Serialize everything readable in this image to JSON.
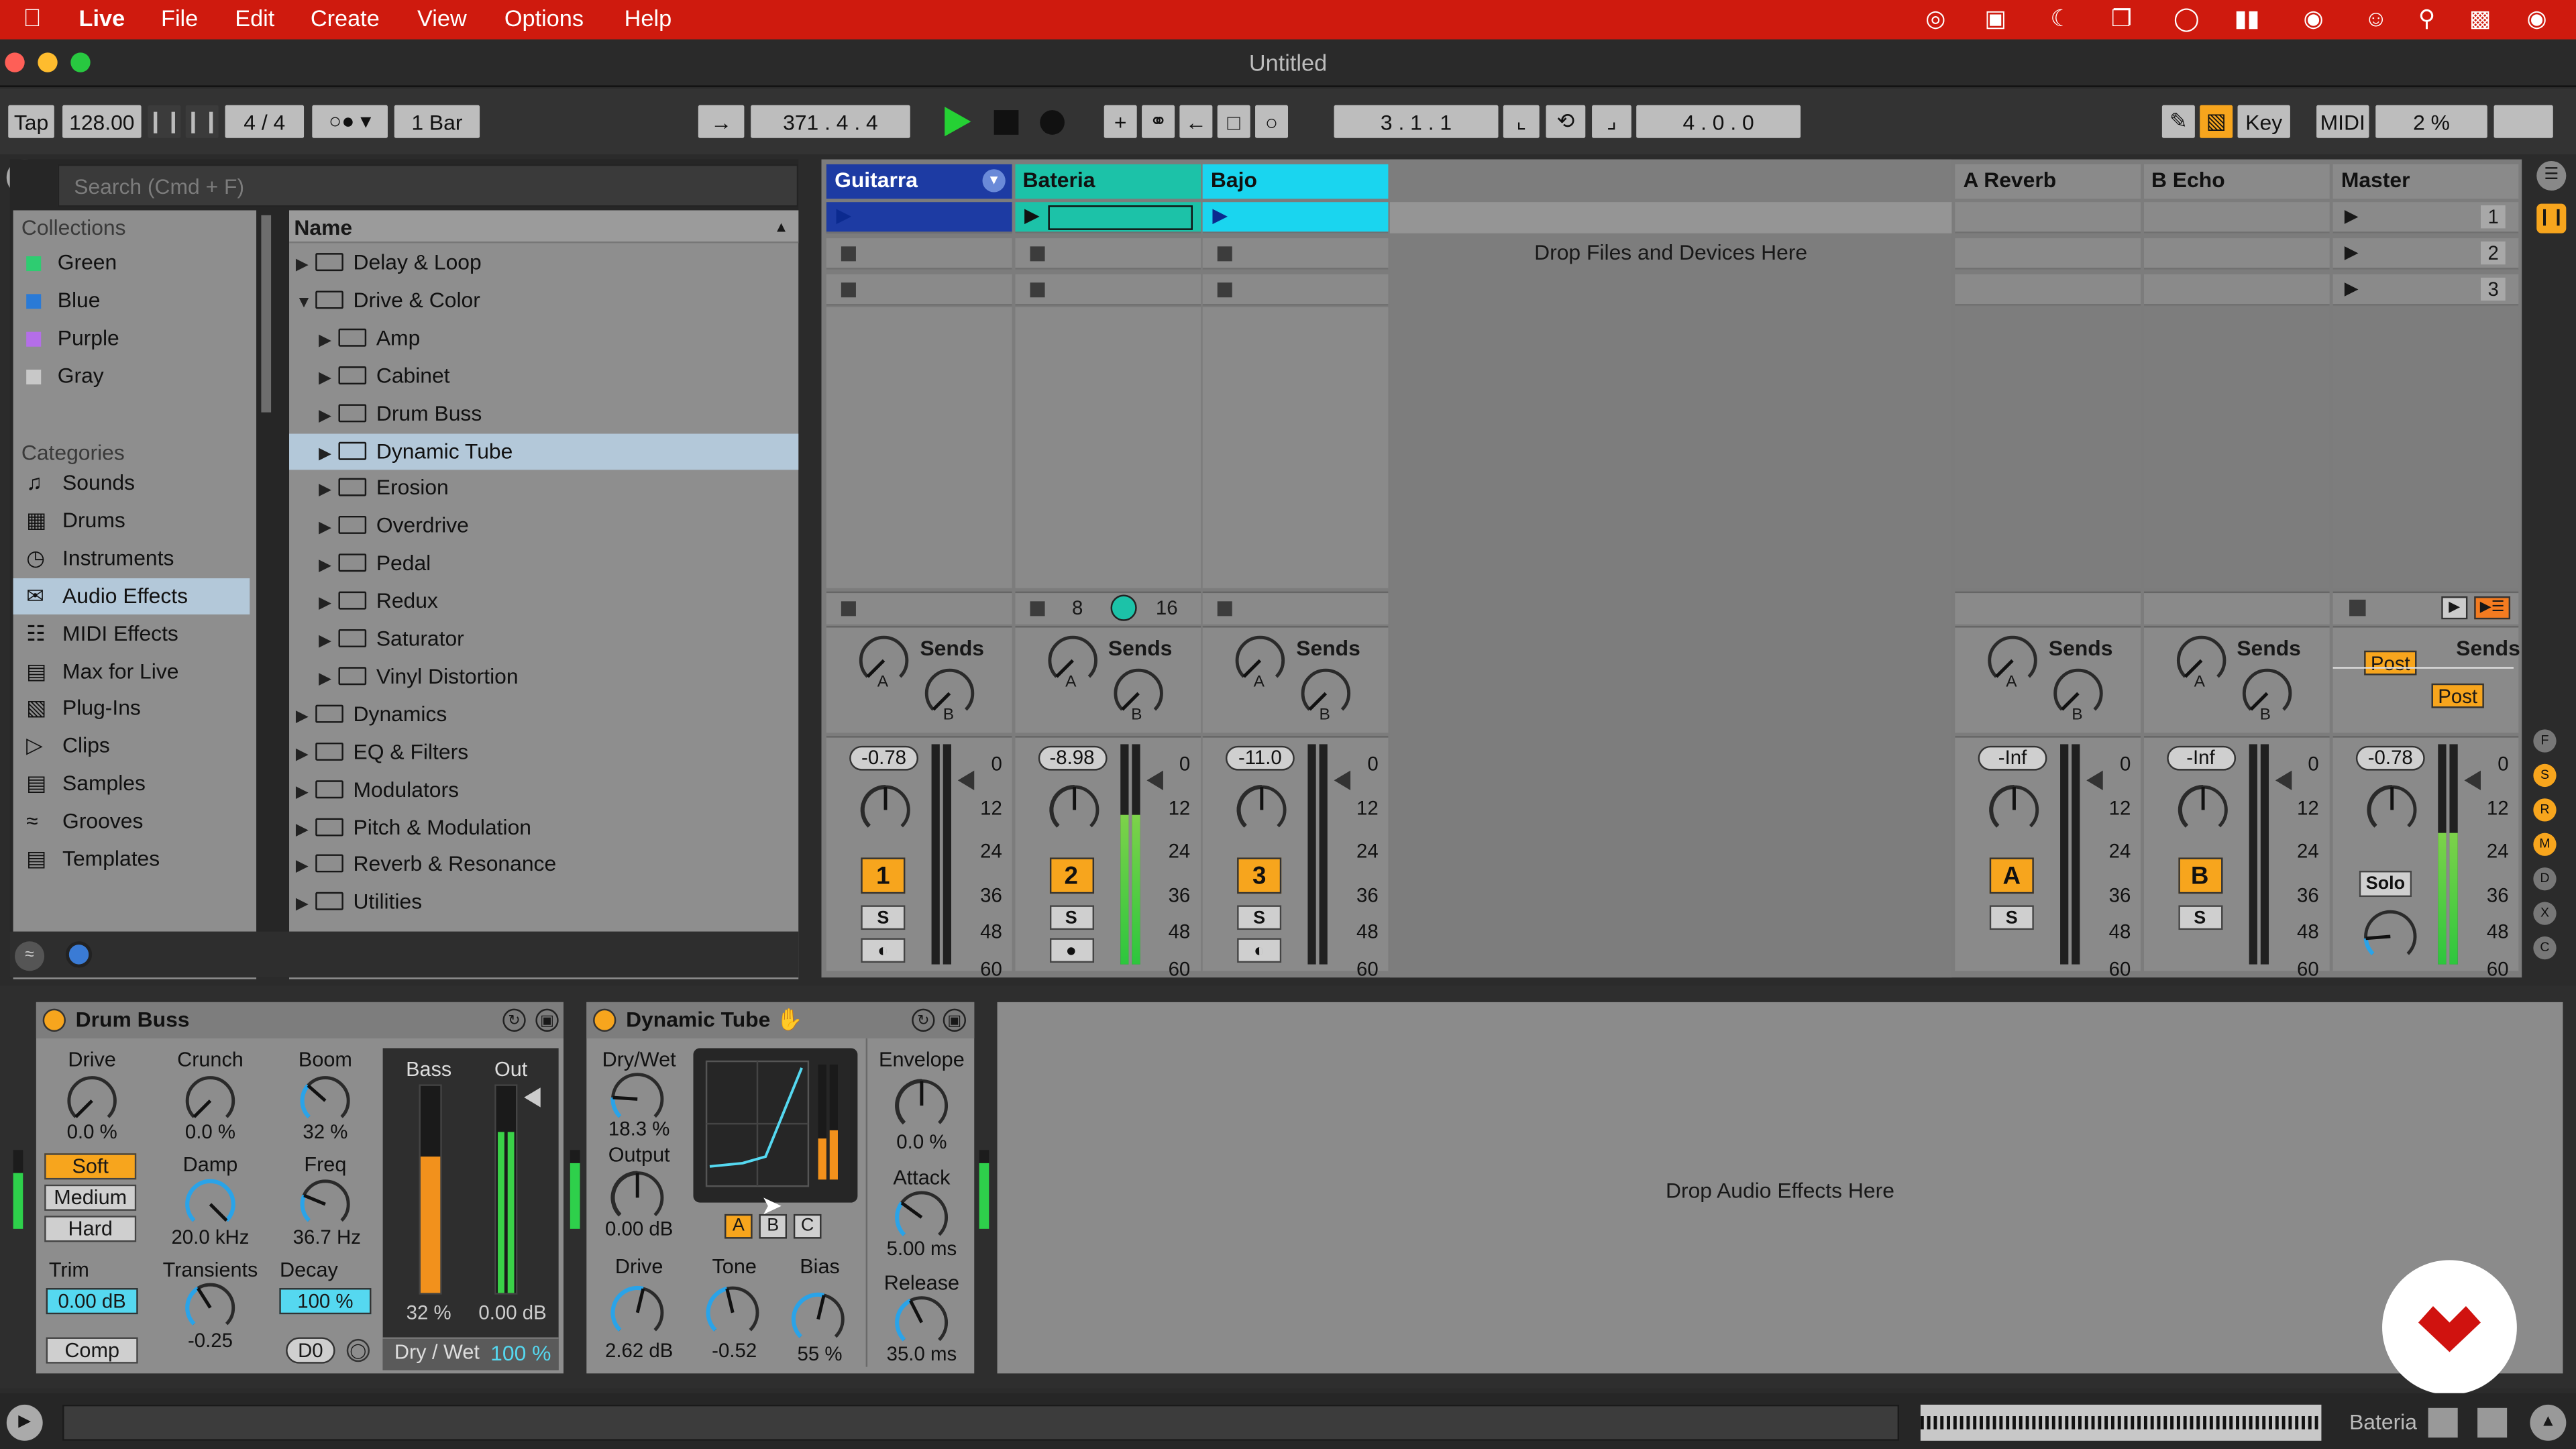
{
  "menubar": {
    "app": "Live",
    "items": [
      "File",
      "Edit",
      "Create",
      "View",
      "Options",
      "Help"
    ]
  },
  "window": {
    "title": "Untitled"
  },
  "control_bar": {
    "tap": "Tap",
    "tempo": "128.00",
    "signature": "4 / 4",
    "quantize": "1 Bar",
    "arrangement_position": "371 .  4 .  4",
    "loop_start": "3 .  1 .  1",
    "loop_length": "4 .  0 .  0",
    "key": "Key",
    "midi": "MIDI",
    "cpu": "2 %"
  },
  "browser": {
    "search_placeholder": "Search (Cmd + F)",
    "collections_header": "Collections",
    "collections": [
      {
        "label": "Green",
        "color": "#2ecc71"
      },
      {
        "label": "Blue",
        "color": "#2a7ad6"
      },
      {
        "label": "Purple",
        "color": "#b46ee8"
      },
      {
        "label": "Gray",
        "color": "#bdbdbd"
      }
    ],
    "categories_header": "Categories",
    "categories": [
      "Sounds",
      "Drums",
      "Instruments",
      "Audio Effects",
      "MIDI Effects",
      "Max for Live",
      "Plug-Ins",
      "Clips",
      "Samples",
      "Grooves",
      "Templates"
    ],
    "selected_category": "Audio Effects",
    "name_header": "Name",
    "items": [
      {
        "label": "Delay & Loop",
        "level": 0,
        "expanded": false
      },
      {
        "label": "Drive & Color",
        "level": 0,
        "expanded": true
      },
      {
        "label": "Amp",
        "level": 1
      },
      {
        "label": "Cabinet",
        "level": 1
      },
      {
        "label": "Drum Buss",
        "level": 1
      },
      {
        "label": "Dynamic Tube",
        "level": 1,
        "selected": true
      },
      {
        "label": "Erosion",
        "level": 1
      },
      {
        "label": "Overdrive",
        "level": 1
      },
      {
        "label": "Pedal",
        "level": 1
      },
      {
        "label": "Redux",
        "level": 1
      },
      {
        "label": "Saturator",
        "level": 1
      },
      {
        "label": "Vinyl Distortion",
        "level": 1
      },
      {
        "label": "Dynamics",
        "level": 0
      },
      {
        "label": "EQ & Filters",
        "level": 0
      },
      {
        "label": "Modulators",
        "level": 0
      },
      {
        "label": "Pitch & Modulation",
        "level": 0
      },
      {
        "label": "Reverb & Resonance",
        "level": 0
      },
      {
        "label": "Utilities",
        "level": 0
      }
    ]
  },
  "session": {
    "drop_text": "Drop Files and Devices Here",
    "sends_label": "Sends",
    "tracks": [
      {
        "name": "Guitarra",
        "color": "#1d3ba3",
        "volume": "-0.78",
        "number": "1",
        "solo": "S"
      },
      {
        "name": "Bateria",
        "color": "#1cc2a8",
        "volume": "-8.98",
        "number": "2",
        "solo": "S",
        "groove_a": "8",
        "groove_b": "16"
      },
      {
        "name": "Bajo",
        "color": "#1ad5ef",
        "volume": "-11.0",
        "number": "3",
        "solo": "S"
      }
    ],
    "returns": [
      {
        "name": "A Reverb",
        "volume": "-Inf",
        "letter": "A",
        "solo": "S"
      },
      {
        "name": "B Echo",
        "volume": "-Inf",
        "letter": "B",
        "solo": "S"
      }
    ],
    "master": {
      "name": "Master",
      "volume": "-0.78",
      "solo": "Solo",
      "post": "Post",
      "scenes": [
        "1",
        "2",
        "3"
      ]
    },
    "meter_scale": [
      "0",
      "12",
      "24",
      "36",
      "48",
      "60"
    ]
  },
  "devices": {
    "drum_buss": {
      "title": "Drum Buss",
      "drive": "Drive",
      "drive_val": "0.0 %",
      "crunch": "Crunch",
      "crunch_val": "0.0 %",
      "boom": "Boom",
      "boom_val": "32 %",
      "soft": "Soft",
      "medium": "Medium",
      "hard": "Hard",
      "damp": "Damp",
      "damp_val": "20.0 kHz",
      "freq": "Freq",
      "freq_val": "36.7 Hz",
      "trim": "Trim",
      "trim_val": "0.00 dB",
      "transients": "Transients",
      "transients_val": "-0.25",
      "decay": "Decay",
      "decay_val": "100 %",
      "comp": "Comp",
      "d0": "D0",
      "bass": "Bass",
      "out": "Out",
      "bass_val": "32 %",
      "out_val": "0.00 dB",
      "drywet": "Dry / Wet",
      "drywet_val": "100 %"
    },
    "dynamic_tube": {
      "title": "Dynamic Tube",
      "drywet": "Dry/Wet",
      "drywet_val": "18.3 %",
      "output": "Output",
      "output_val": "0.00 dB",
      "a": "A",
      "b": "B",
      "c": "C",
      "drive": "Drive",
      "drive_val": "2.62 dB",
      "tone": "Tone",
      "tone_val": "-0.52",
      "bias": "Bias",
      "bias_val": "55 %",
      "envelope": "Envelope",
      "envelope_val": "0.0 %",
      "attack": "Attack",
      "attack_val": "5.00 ms",
      "release": "Release",
      "release_val": "35.0 ms"
    },
    "drop_text": "Drop Audio Effects Here"
  },
  "status": {
    "track": "Bateria"
  }
}
